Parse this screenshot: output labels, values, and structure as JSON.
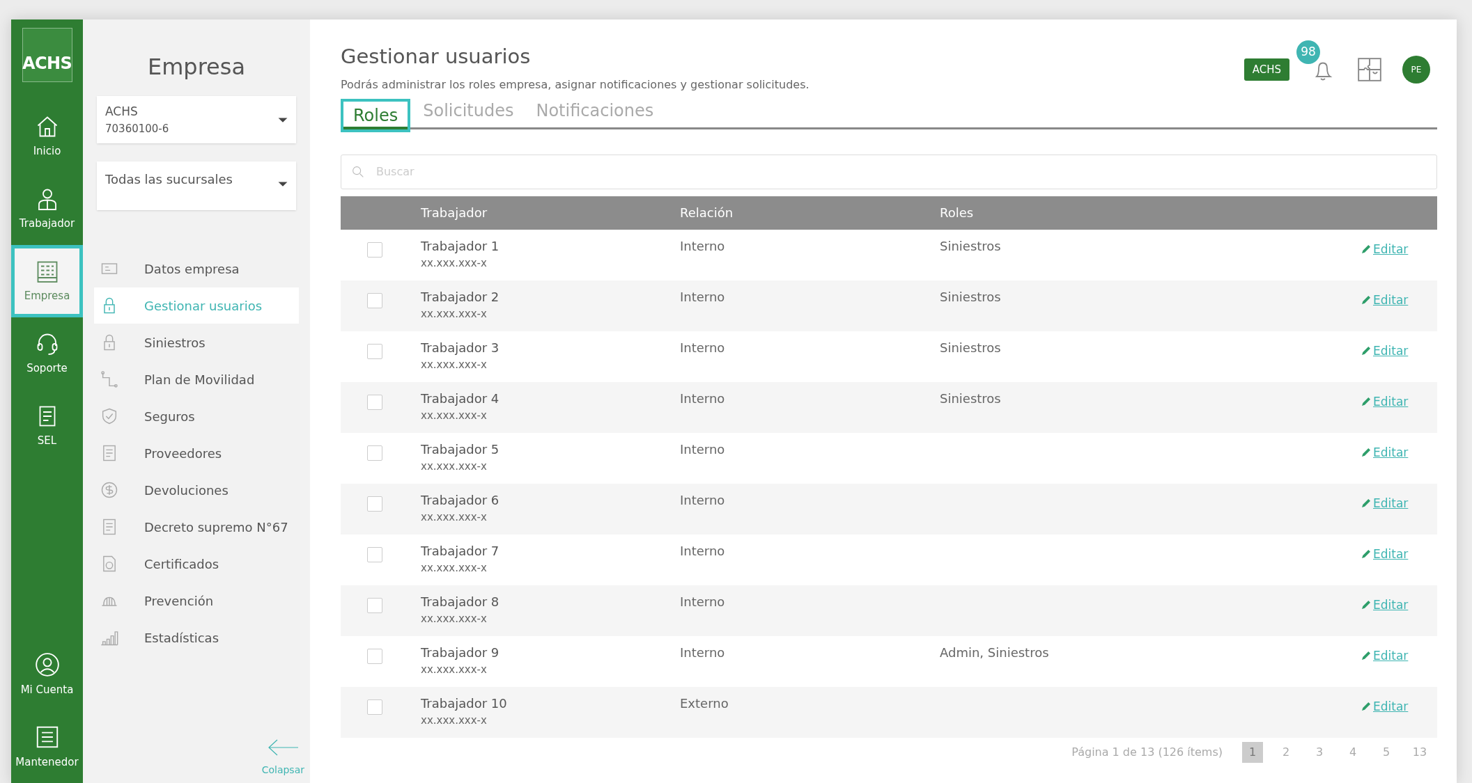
{
  "rail": {
    "logo": "ACHS",
    "items": [
      {
        "label": "Inicio",
        "kind": "home",
        "selected": false
      },
      {
        "label": "Trabajador",
        "kind": "worker",
        "selected": false
      },
      {
        "label": "Empresa",
        "kind": "building",
        "selected": true
      },
      {
        "label": "Soporte",
        "kind": "headset",
        "selected": false
      },
      {
        "label": "SEL",
        "kind": "doc",
        "selected": false
      }
    ],
    "bottom_items": [
      {
        "label": "Mi Cuenta",
        "kind": "user"
      },
      {
        "label": "Mantenedor",
        "kind": "list"
      }
    ]
  },
  "sidebar": {
    "title": "Empresa",
    "company_select": {
      "name": "ACHS",
      "rut": "70360100-6"
    },
    "branch_select": {
      "value": "Todas las sucursales"
    },
    "items": [
      {
        "label": "Datos empresa",
        "kind": "card",
        "selected": false
      },
      {
        "label": "Gestionar usuarios",
        "kind": "lock",
        "selected": true
      },
      {
        "label": "Siniestros",
        "kind": "lock",
        "selected": false
      },
      {
        "label": "Plan de Movilidad",
        "kind": "route",
        "selected": false
      },
      {
        "label": "Seguros",
        "kind": "shield",
        "selected": false
      },
      {
        "label": "Proveedores",
        "kind": "doc",
        "selected": false
      },
      {
        "label": "Devoluciones",
        "kind": "coin",
        "selected": false
      },
      {
        "label": "Decreto supremo N°67",
        "kind": "doc",
        "selected": false
      },
      {
        "label": "Certificados",
        "kind": "cert",
        "selected": false
      },
      {
        "label": "Prevención",
        "kind": "helmet",
        "selected": false
      },
      {
        "label": "Estadísticas",
        "kind": "bars",
        "selected": false
      }
    ],
    "collapse": "Colapsar"
  },
  "header": {
    "title": "Gestionar usuarios",
    "subtitle": "Podrás administrar los roles empresa, asignar notificaciones y gestionar solicitudes.",
    "company_badge": "ACHS",
    "notifications": "98",
    "avatar": "PE"
  },
  "tabs": [
    {
      "label": "Roles",
      "selected": true
    },
    {
      "label": "Solicitudes",
      "selected": false
    },
    {
      "label": "Notificaciones",
      "selected": false
    }
  ],
  "search": {
    "placeholder": "Buscar"
  },
  "table": {
    "columns": [
      "Trabajador",
      "Relación",
      "Roles"
    ],
    "rows": [
      {
        "name": "Trabajador 1",
        "rut": "xx.xxx.xxx-x",
        "relation": "Interno",
        "roles": "Siniestros",
        "checked": false,
        "action": "Editar"
      },
      {
        "name": "Trabajador 2",
        "rut": "xx.xxx.xxx-x",
        "relation": "Interno",
        "roles": "Siniestros",
        "checked": false,
        "action": "Editar"
      },
      {
        "name": "Trabajador 3",
        "rut": "xx.xxx.xxx-x",
        "relation": "Interno",
        "roles": "Siniestros",
        "checked": false,
        "action": "Editar"
      },
      {
        "name": "Trabajador 4",
        "rut": "xx.xxx.xxx-x",
        "relation": "Interno",
        "roles": "Siniestros",
        "checked": false,
        "action": "Editar"
      },
      {
        "name": "Trabajador 5",
        "rut": "xx.xxx.xxx-x",
        "relation": "Interno",
        "checked": false,
        "action": "Editar"
      },
      {
        "name": "Trabajador 6",
        "rut": "xx.xxx.xxx-x",
        "relation": "Interno",
        "checked": false,
        "action": "Editar"
      },
      {
        "name": "Trabajador 7",
        "rut": "xx.xxx.xxx-x",
        "relation": "Interno",
        "checked": false,
        "action": "Editar"
      },
      {
        "name": "Trabajador 8",
        "rut": "xx.xxx.xxx-x",
        "relation": "Interno",
        "checked": false,
        "action": "Editar"
      },
      {
        "name": "Trabajador 9",
        "rut": "xx.xxx.xxx-x",
        "relation": "Interno",
        "roles": "Admin, Siniestros",
        "checked": false,
        "action": "Editar"
      },
      {
        "name": "Trabajador 10",
        "rut": "xx.xxx.xxx-x",
        "relation": "Externo",
        "checked": false,
        "action": "Editar"
      }
    ]
  },
  "pagination": {
    "summary": "Página 1 de 13 (126 ítems)",
    "pages": [
      {
        "label": "1",
        "selected": true
      },
      {
        "label": "2",
        "selected": false
      },
      {
        "label": "3",
        "selected": false
      },
      {
        "label": "4",
        "selected": false
      },
      {
        "label": "5",
        "selected": false
      },
      {
        "label": "13",
        "selected": false
      }
    ]
  }
}
